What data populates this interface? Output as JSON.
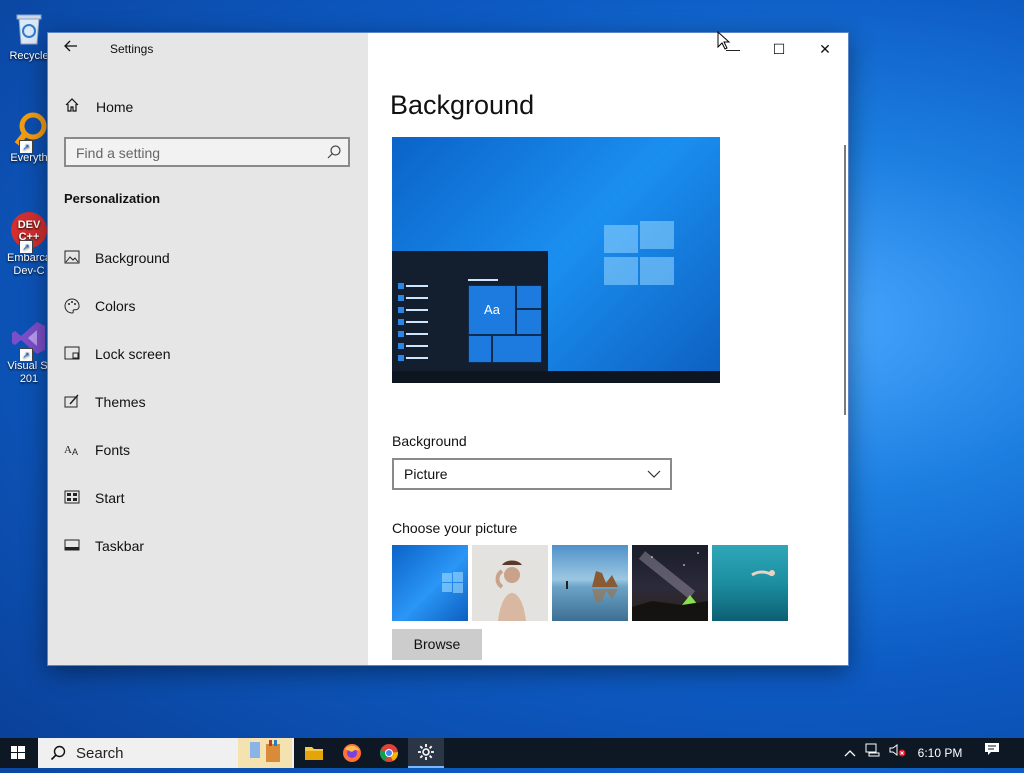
{
  "desktop": {
    "icons": [
      {
        "label": "Recycle",
        "icon": "recycle-bin-icon"
      },
      {
        "label": "Everyth",
        "icon": "everything-search-icon"
      },
      {
        "label": "Embarca Dev-C",
        "icon": "devcpp-icon"
      },
      {
        "label": "Visual St 201",
        "icon": "visual-studio-icon"
      }
    ]
  },
  "window": {
    "title": "Settings",
    "controls": {
      "minimize": "—",
      "maximize": "☐",
      "close": "✕"
    }
  },
  "sidebar": {
    "home_label": "Home",
    "search_placeholder": "Find a setting",
    "section_title": "Personalization",
    "items": [
      {
        "label": "Background",
        "icon": "picture-icon"
      },
      {
        "label": "Colors",
        "icon": "palette-icon"
      },
      {
        "label": "Lock screen",
        "icon": "lock-screen-icon"
      },
      {
        "label": "Themes",
        "icon": "themes-brush-icon"
      },
      {
        "label": "Fonts",
        "icon": "fonts-icon"
      },
      {
        "label": "Start",
        "icon": "start-icon"
      },
      {
        "label": "Taskbar",
        "icon": "taskbar-icon"
      }
    ]
  },
  "main": {
    "page_title": "Background",
    "preview": {
      "tile_text": "Aa"
    },
    "background_label": "Background",
    "background_value": "Picture",
    "choose_label": "Choose your picture",
    "thumbnails": [
      "windows-hero",
      "woman-portrait",
      "beach-rocks",
      "night-sky-tent",
      "underwater-swimmer"
    ],
    "browse_label": "Browse"
  },
  "taskbar": {
    "search_placeholder": "Search",
    "apps": [
      "file-explorer",
      "firefox",
      "chrome",
      "settings"
    ],
    "time": "6:10 PM"
  },
  "colors": {
    "accent": "#0078d7",
    "sidebar_bg": "#e6e6e6",
    "taskbar_bg": "#0e1724"
  }
}
